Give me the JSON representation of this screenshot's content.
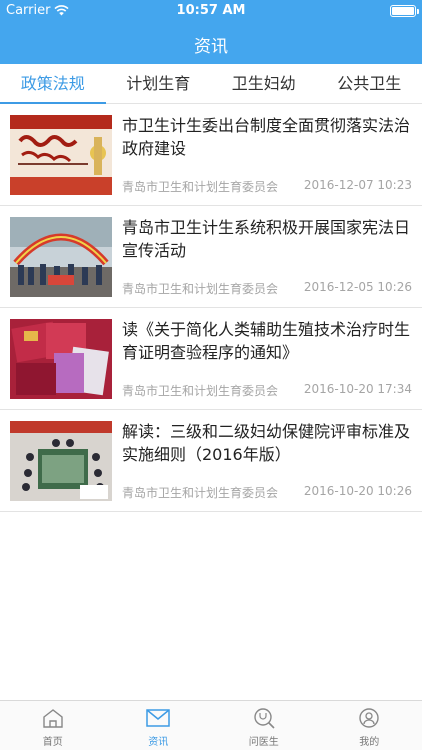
{
  "status": {
    "carrier": "Carrier",
    "time": "10:57 AM"
  },
  "nav": {
    "title": "资讯"
  },
  "tabs": [
    {
      "label": "政策法规"
    },
    {
      "label": "计划生育"
    },
    {
      "label": "卫生妇幼"
    },
    {
      "label": "公共卫生"
    }
  ],
  "news": [
    {
      "title": "市卫生计生委出台制度全面贯彻落实法治政府建设",
      "source": "青岛市卫生和计划生育委员会",
      "date": "2016-12-07 10:23",
      "image": "banner-rule-of-law"
    },
    {
      "title": "青岛市卫生计生系统积极开展国家宪法日宣传活动",
      "source": "青岛市卫生和计划生育委员会",
      "date": "2016-12-05 10:26",
      "image": "outdoor-event-crowd"
    },
    {
      "title": "读《关于简化人类辅助生殖技术治疗时生育证明查验程序的通知》",
      "source": "青岛市卫生和计划生育委员会",
      "date": "2016-10-20 17:34",
      "image": "certificate-booklets"
    },
    {
      "title": "解读：三级和二级妇幼保健院评审标准及实施细则（2016年版）",
      "source": "青岛市卫生和计划生育委员会",
      "date": "2016-10-20 10:26",
      "image": "meeting-room"
    }
  ],
  "tabbar": [
    {
      "label": "首页",
      "icon": "home-icon"
    },
    {
      "label": "资讯",
      "icon": "mail-icon"
    },
    {
      "label": "问医生",
      "icon": "stethoscope-search-icon"
    },
    {
      "label": "我的",
      "icon": "user-icon"
    }
  ],
  "colors": {
    "brand": "#44a6ee",
    "accent": "#3d9be5"
  }
}
